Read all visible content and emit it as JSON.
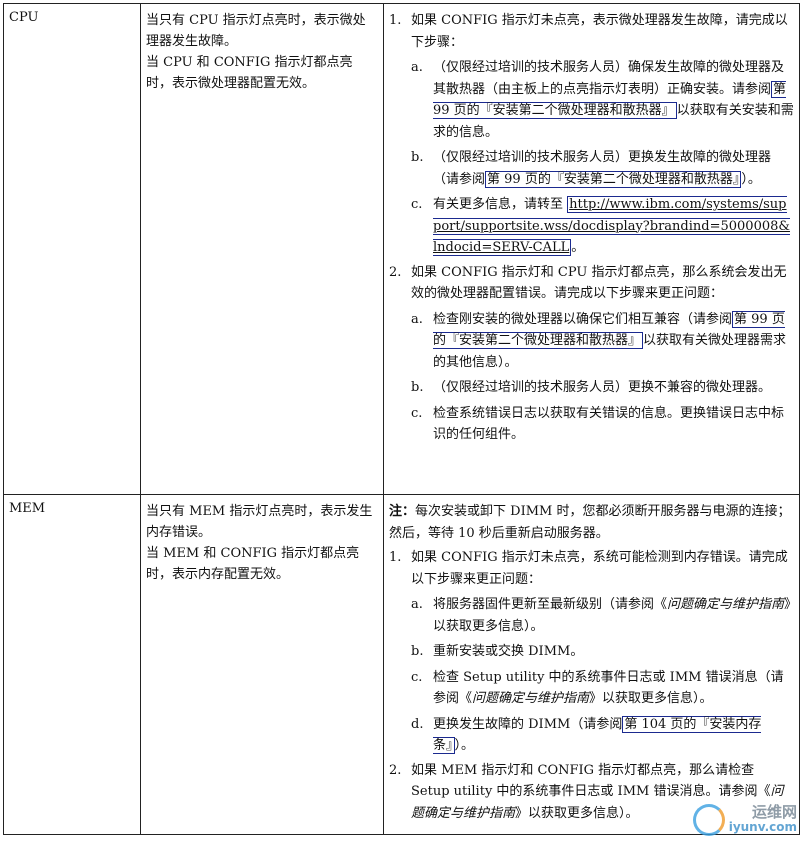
{
  "rows": [
    {
      "component": "CPU",
      "desc1": "当只有 CPU 指示灯点亮时，表示微处理器发生故障。",
      "desc2": "当 CPU 和 CONFIG 指示灯都点亮时，表示微处理器配置无效。",
      "step1_num": "1.",
      "step1_text": "如果 CONFIG 指示灯未点亮，表示微处理器发生故障，请完成以下步骤：",
      "s1a_letter": "a.",
      "s1a_pre": "（仅限经过培训的技术服务人员）确保发生故障的微处理器及其散热器（由主板上的点亮指示灯表明）正确安装。请参阅",
      "s1a_link": "第 99 页的『安装第二个微处理器和散热器』",
      "s1a_post": "以获取有关安装和需求的信息。",
      "s1b_letter": "b.",
      "s1b_pre": "（仅限经过培训的技术服务人员）更换发生故障的微处理器（请参阅",
      "s1b_link": "第 99 页的『安装第二个微处理器和散热器』",
      "s1b_post": "）。",
      "s1c_letter": "c.",
      "s1c_pre": "有关更多信息，请转至 ",
      "s1c_url": "http://www.ibm.com/systems/support/supportsite.wss/docdisplay?brandind=5000008&lndocid=SERV-CALL",
      "s1c_post": "。",
      "step2_num": "2.",
      "step2_text": "如果 CONFIG 指示灯和 CPU 指示灯都点亮，那么系统会发出无效的微处理器配置错误。请完成以下步骤来更正问题：",
      "s2a_letter": "a.",
      "s2a_pre": "检查刚安装的微处理器以确保它们相互兼容（请参阅",
      "s2a_link": "第 99 页的『安装第二个微处理器和散热器』",
      "s2a_post": "以获取有关微处理器需求的其他信息）。",
      "s2b_letter": "b.",
      "s2b_text": "（仅限经过培训的技术服务人员）更换不兼容的微处理器。",
      "s2c_letter": "c.",
      "s2c_text": "检查系统错误日志以获取有关错误的信息。更换错误日志中标识的任何组件。"
    },
    {
      "component": "MEM",
      "desc1": "当只有 MEM 指示灯点亮时，表示发生内存错误。",
      "desc2": "当 MEM 和 CONFIG 指示灯都点亮时，表示内存配置无效。",
      "note_label": "注：",
      "note_text": "每次安装或卸下 DIMM 时，您都必须断开服务器与电源的连接；然后，等待 10 秒后重新启动服务器。",
      "step1_num": "1.",
      "step1_text": "如果 CONFIG 指示灯未点亮，系统可能检测到内存错误。请完成以下步骤来更正问题：",
      "s1a_letter": "a.",
      "s1a_pre": "将服务器固件更新至最新级别（请参阅《",
      "s1a_ital": "问题确定与维护指南",
      "s1a_post": "》以获取更多信息）。",
      "s1b_letter": "b.",
      "s1b_text": "重新安装或交换 DIMM。",
      "s1c_letter": "c.",
      "s1c_pre": "检查 Setup utility 中的系统事件日志或 IMM 错误消息（请参阅《",
      "s1c_ital": "问题确定与维护指南",
      "s1c_post": "》以获取更多信息）。",
      "s1d_letter": "d.",
      "s1d_pre": "更换发生故障的 DIMM（请参阅",
      "s1d_link": "第 104 页的『安装内存条』",
      "s1d_post": "）。",
      "step2_num": "2.",
      "step2_pre": "如果 MEM 指示灯和 CONFIG 指示灯都点亮，那么请检查 Setup utility 中的系统事件日志或 IMM 错误消息。请参阅《",
      "step2_ital": "问题确定与维护指南",
      "step2_post": "》以获取更多信息）。"
    }
  ],
  "watermark": {
    "cn": "运维网",
    "en": "iyunv.com"
  }
}
